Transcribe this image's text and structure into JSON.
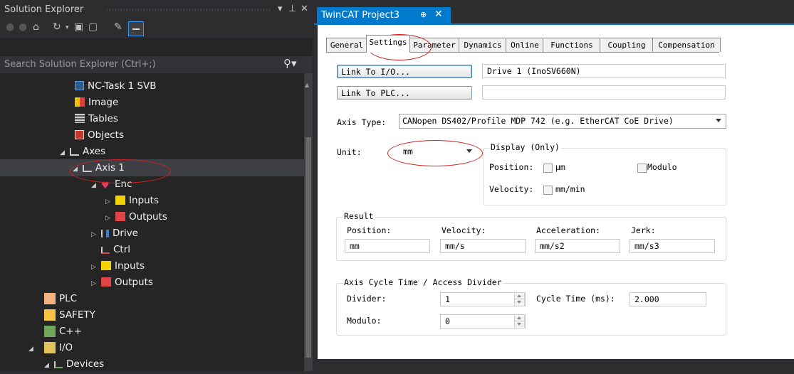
{
  "solution_explorer": {
    "title": "Solution Explorer",
    "title_controls": {
      "dropdown": "▾",
      "pin": "⊥",
      "close": "✕"
    },
    "search_placeholder": "Search Solution Explorer (Ctrl+;)",
    "tree": [
      {
        "label": "NC-Task 1 SVB",
        "icon": "nc-task-icon",
        "level": 0
      },
      {
        "label": "Image",
        "icon": "image-icon",
        "level": 0
      },
      {
        "label": "Tables",
        "icon": "tables-icon",
        "level": 0
      },
      {
        "label": "Objects",
        "icon": "objects-icon",
        "level": 0
      },
      {
        "label": "Axes",
        "icon": "axes-icon",
        "level": 0
      },
      {
        "label": "Axis 1",
        "icon": "axis-icon",
        "level": 1,
        "selected": true
      },
      {
        "label": "Enc",
        "icon": "encoder-icon",
        "level": 2
      },
      {
        "label": "Inputs",
        "icon": "inputs-icon",
        "level": 3
      },
      {
        "label": "Outputs",
        "icon": "outputs-icon",
        "level": 3
      },
      {
        "label": "Drive",
        "icon": "drive-icon",
        "level": 2
      },
      {
        "label": "Ctrl",
        "icon": "ctrl-icon",
        "level": 2
      },
      {
        "label": "Inputs",
        "icon": "inputs-icon",
        "level": 2
      },
      {
        "label": "Outputs",
        "icon": "outputs-icon",
        "level": 2
      },
      {
        "label": "PLC",
        "icon": "plc-icon",
        "level": -1
      },
      {
        "label": "SAFETY",
        "icon": "safety-icon",
        "level": -1
      },
      {
        "label": "C++",
        "icon": "cpp-icon",
        "level": -1
      },
      {
        "label": "I/O",
        "icon": "io-icon",
        "level": -1
      },
      {
        "label": "Devices",
        "icon": "devices-icon",
        "level": 0
      }
    ]
  },
  "document": {
    "tab_title": "TwinCAT Project3",
    "tab_pin": "⊕",
    "tab_close": "✕",
    "prop_tabs": [
      "General",
      "Settings",
      "Parameter",
      "Dynamics",
      "Online",
      "Functions",
      "Coupling",
      "Compensation"
    ],
    "active_tab": "Settings",
    "link_io_label": "Link To I/O...",
    "link_io_value": "Drive 1 (InoSV660N)",
    "link_plc_label": "Link To PLC...",
    "link_plc_value": "",
    "axis_type_label": "Axis Type:",
    "axis_type_value": "CANopen DS402/Profile MDP 742 (e.g. EtherCAT CoE Drive)",
    "unit_label": "Unit:",
    "unit_value": "mm",
    "display_caption": "Display (Only)",
    "display_position_label": "Position:",
    "display_position_unit": "μm",
    "display_modulo_label": "Modulo",
    "display_velocity_label": "Velocity:",
    "display_velocity_unit": "mm/min",
    "result_caption": "Result",
    "result_labels": [
      "Position:",
      "Velocity:",
      "Acceleration:",
      "Jerk:"
    ],
    "result_values": [
      "mm",
      "mm/s",
      "mm/s2",
      "mm/s3"
    ],
    "cycle_caption": "Axis Cycle Time / Access Divider",
    "divider_label": "Divider:",
    "divider_value": "1",
    "cycle_time_label": "Cycle Time (ms):",
    "cycle_time_value": "2.000",
    "modulo_label": "Modulo:",
    "modulo_value": "0"
  },
  "colors": {
    "accent": "#007acc",
    "annotation": "#d42020",
    "dark_bg": "#252526"
  }
}
